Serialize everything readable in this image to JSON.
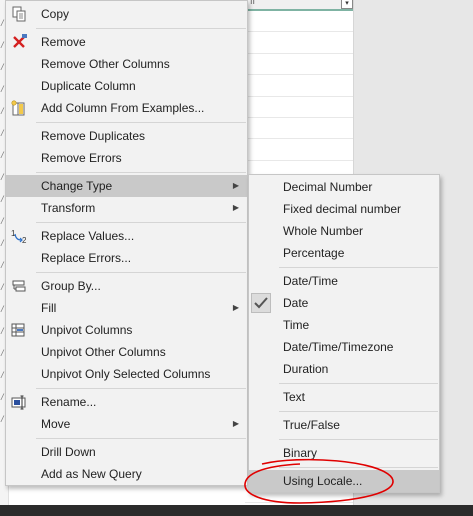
{
  "background": {
    "column_header_fragment": "ıı",
    "dropdown_glyph": "▾",
    "side_glyph": "/"
  },
  "context_menu": {
    "copy": "Copy",
    "remove": "Remove",
    "remove_other_columns": "Remove Other Columns",
    "duplicate_column": "Duplicate Column",
    "add_column_from_examples": "Add Column From Examples...",
    "remove_duplicates": "Remove Duplicates",
    "remove_errors": "Remove Errors",
    "change_type": "Change Type",
    "transform": "Transform",
    "replace_values": "Replace Values...",
    "replace_errors": "Replace Errors...",
    "group_by": "Group By...",
    "fill": "Fill",
    "unpivot_columns": "Unpivot Columns",
    "unpivot_other_columns": "Unpivot Other Columns",
    "unpivot_only_selected_columns": "Unpivot Only Selected Columns",
    "rename": "Rename...",
    "move": "Move",
    "drill_down": "Drill Down",
    "add_as_new_query": "Add as New Query",
    "submenu_arrow": "▶"
  },
  "change_type_submenu": {
    "decimal_number": "Decimal Number",
    "fixed_decimal_number": "Fixed decimal number",
    "whole_number": "Whole Number",
    "percentage": "Percentage",
    "date_time": "Date/Time",
    "date": "Date",
    "time": "Time",
    "date_time_timezone": "Date/Time/Timezone",
    "duration": "Duration",
    "text": "Text",
    "true_false": "True/False",
    "binary": "Binary",
    "using_locale": "Using Locale..."
  },
  "state": {
    "checked_type": "Date",
    "highlighted_main_item": "Change Type",
    "highlighted_sub_item": "Using Locale..."
  },
  "icons": {
    "copy": "copy-icon",
    "remove": "remove-x-icon",
    "add_column_from_examples": "add-column-examples-icon",
    "replace_values": "replace-values-icon",
    "group_by": "group-by-icon",
    "unpivot_columns": "unpivot-icon",
    "rename": "rename-icon",
    "checkmark": "checkmark-icon"
  },
  "colors": {
    "menu_background": "#f2f2f2",
    "highlight": "#c9c9c9",
    "annotation_red": "#e00000",
    "remove_icon_red": "#d42020"
  }
}
